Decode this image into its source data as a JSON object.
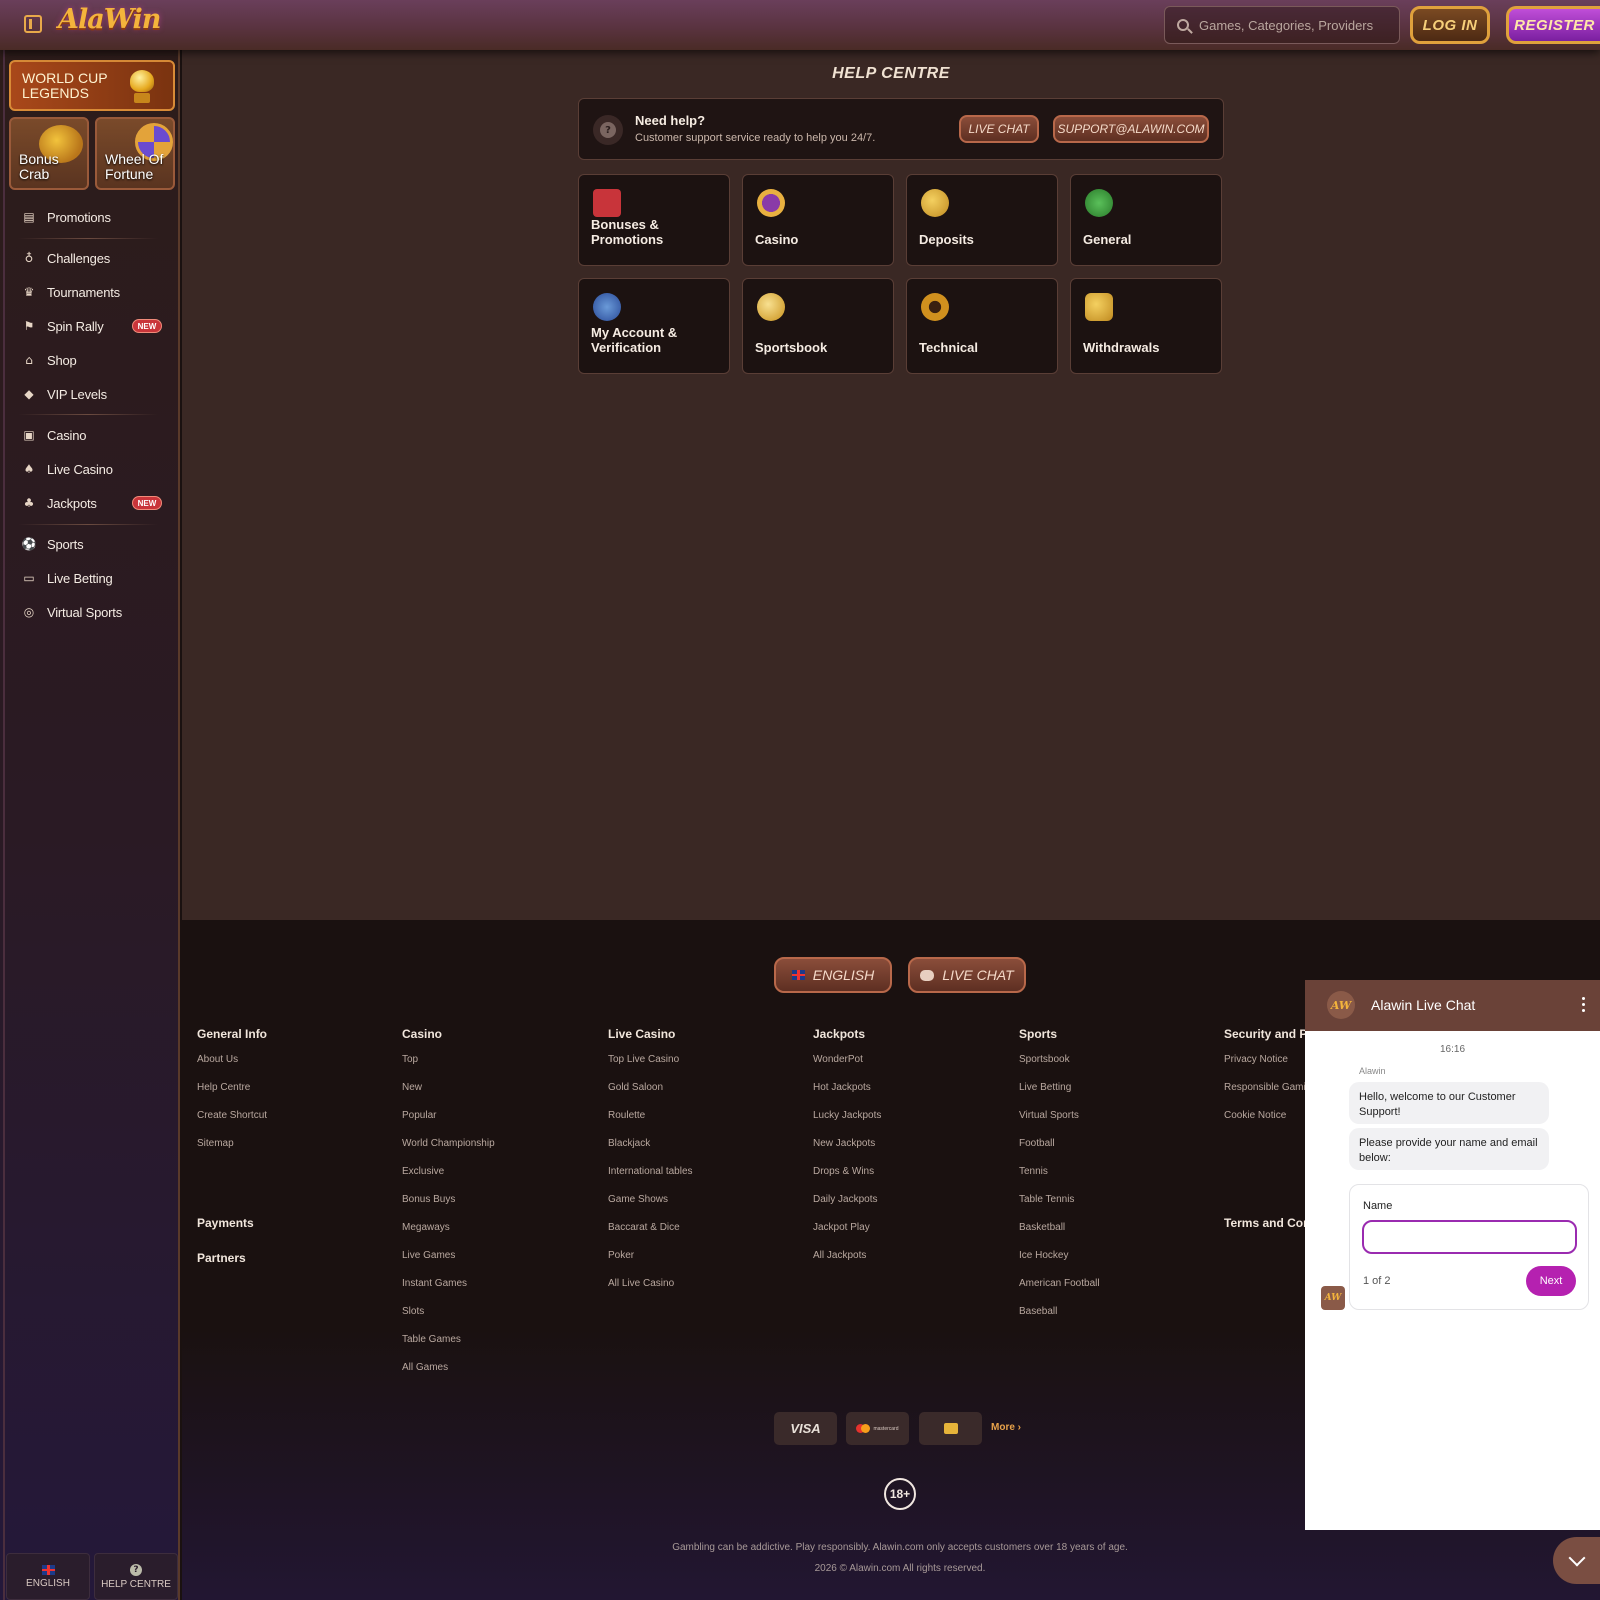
{
  "header": {
    "logo": "AlaWin",
    "search_placeholder": "Games, Categories, Providers",
    "login": "Log In",
    "register": "Register"
  },
  "sidebar": {
    "promo_big": "World Cup Legends",
    "promo_crab": "Bonus Crab",
    "promo_wheel": "Wheel Of Fortune",
    "items": [
      {
        "label": "Promotions",
        "icon": "promotions-icon"
      },
      {
        "label": "Challenges",
        "icon": "medal-icon"
      },
      {
        "label": "Tournaments",
        "icon": "trophy-icon"
      },
      {
        "label": "Spin Rally",
        "icon": "flag-race-icon",
        "badge": "NEW"
      },
      {
        "label": "Shop",
        "icon": "shop-icon"
      },
      {
        "label": "VIP Levels",
        "icon": "diamond-icon"
      },
      {
        "label": "Casino",
        "icon": "slot-icon"
      },
      {
        "label": "Live Casino",
        "icon": "cards-icon"
      },
      {
        "label": "Jackpots",
        "icon": "clover-icon",
        "badge": "NEW"
      },
      {
        "label": "Sports",
        "icon": "sports-icon"
      },
      {
        "label": "Live Betting",
        "icon": "live-icon"
      },
      {
        "label": "Virtual Sports",
        "icon": "virtual-icon"
      }
    ],
    "bottom_english": "ENGLISH",
    "bottom_help": "HELP CENTRE"
  },
  "main": {
    "title": "Help Centre",
    "help_title": "Need help?",
    "help_sub": "Customer support service ready to help you 24/7.",
    "live_chat": "Live Chat",
    "email": "support@alawin.com",
    "categories": [
      {
        "label": "Bonuses & Promotions",
        "color": "#c8343a"
      },
      {
        "label": "Casino",
        "color": "#8a3aa8"
      },
      {
        "label": "Deposits",
        "color": "#d8a02a"
      },
      {
        "label": "General",
        "color": "#3a9a3a"
      },
      {
        "label": "My Account & Verification",
        "color": "#3a6ac8"
      },
      {
        "label": "Sportsbook",
        "color": "#d8a02a"
      },
      {
        "label": "Technical",
        "color": "#c07a1a"
      },
      {
        "label": "Withdrawals",
        "color": "#d8a02a"
      }
    ]
  },
  "footer": {
    "english": "English",
    "live_chat": "Live Chat",
    "columns": [
      {
        "head": "General Info",
        "links": [
          "About Us",
          "Help Centre",
          "Create Shortcut",
          "Sitemap"
        ]
      },
      {
        "head": "Casino",
        "links": [
          "Top",
          "New",
          "Popular",
          "World Championship",
          "Exclusive",
          "Bonus Buys",
          "Megaways",
          "Live Games",
          "Instant Games",
          "Slots",
          "Table Games",
          "All Games"
        ]
      },
      {
        "head": "Live Casino",
        "links": [
          "Top Live Casino",
          "Gold Saloon",
          "Roulette",
          "Blackjack",
          "International tables",
          "Game Shows",
          "Baccarat & Dice",
          "Poker",
          "All Live Casino"
        ]
      },
      {
        "head": "Jackpots",
        "links": [
          "WonderPot",
          "Hot Jackpots",
          "Lucky Jackpots",
          "New Jackpots",
          "Drops & Wins",
          "Daily Jackpots",
          "Jackpot Play",
          "All Jackpots"
        ]
      },
      {
        "head": "Sports",
        "links": [
          "Sportsbook",
          "Live Betting",
          "Virtual Sports",
          "Football",
          "Tennis",
          "Table Tennis",
          "Basketball",
          "Ice Hockey",
          "American Football",
          "Baseball"
        ]
      },
      {
        "head": "Security and Privacy",
        "links": [
          "Privacy Notice",
          "Responsible Gaming",
          "Cookie Notice"
        ]
      }
    ],
    "payments": "Payments",
    "partners": "Partners",
    "terms": "Terms and Conditions",
    "visa": "VISA",
    "mastercard": "mastercard",
    "more": "More",
    "age": "18+",
    "disclaimer": "Gambling can be addictive. Play responsibly. Alawin.com only accepts customers over 18 years of age.",
    "copyright": "2026 © Alawin.com All rights reserved."
  },
  "chat": {
    "title": "Alawin Live Chat",
    "avatar": "AW",
    "time": "16:16",
    "sender": "Alawin",
    "msg1": "Hello, welcome to our Customer Support!",
    "msg2": "Please provide your name and email below:",
    "form_label": "Name",
    "step": "1 of 2",
    "next": "Next"
  }
}
